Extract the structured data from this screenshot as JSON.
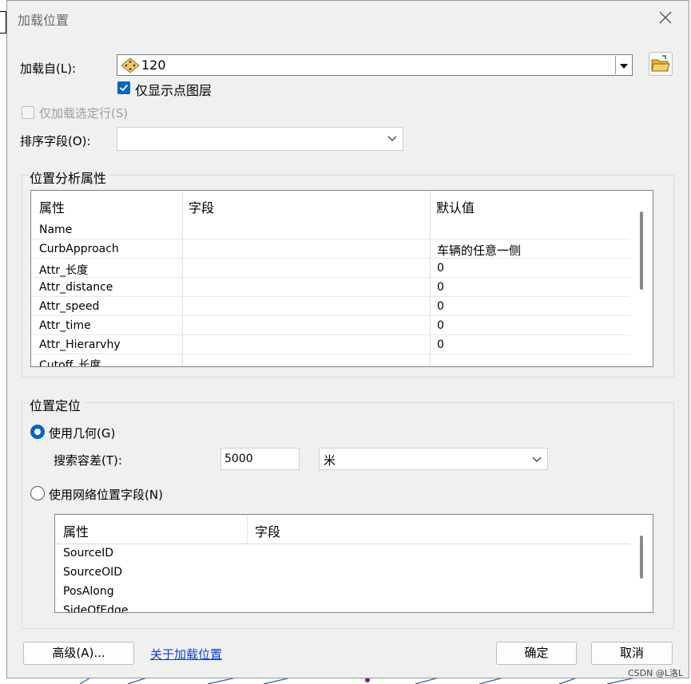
{
  "window": {
    "title": "加载位置",
    "close_icon": "close-icon"
  },
  "load_from": {
    "label": "加载自(L):",
    "value": "120",
    "layer_icon": "point-layer-icon",
    "open_icon": "folder-open-icon"
  },
  "only_point_layers": {
    "label": "仅显示点图层",
    "checked": true
  },
  "only_selected_rows": {
    "label": "仅加载选定行(S)",
    "checked": false,
    "enabled": false
  },
  "sort_field": {
    "label": "排序字段(O):",
    "value": ""
  },
  "analysis_props": {
    "title": "位置分析属性",
    "columns": [
      "属性",
      "字段",
      "默认值"
    ],
    "rows": [
      {
        "prop": "Name",
        "field": "",
        "default": ""
      },
      {
        "prop": "CurbApproach",
        "field": "",
        "default": "车辆的任意一侧"
      },
      {
        "prop": "Attr_长度",
        "field": "",
        "default": "0"
      },
      {
        "prop": "Attr_distance",
        "field": "",
        "default": "0"
      },
      {
        "prop": "Attr_speed",
        "field": "",
        "default": "0"
      },
      {
        "prop": "Attr_time",
        "field": "",
        "default": "0"
      },
      {
        "prop": "Attr_Hierarvhy",
        "field": "",
        "default": "0"
      },
      {
        "prop": "Cutoff_长度",
        "field": "",
        "default": ""
      }
    ]
  },
  "positioning": {
    "title": "位置定位",
    "use_geometry": {
      "label": "使用几何(G)",
      "selected": true
    },
    "tolerance": {
      "label": "搜索容差(T):",
      "value": "5000",
      "unit": "米"
    },
    "use_network_fields": {
      "label": "使用网络位置字段(N)",
      "selected": false
    },
    "columns": [
      "属性",
      "字段"
    ],
    "rows": [
      "SourceID",
      "SourceOID",
      "PosAlong",
      "SideOfEdge"
    ]
  },
  "buttons": {
    "advanced": "高级(A)...",
    "about": "关于加载位置",
    "ok": "确定",
    "cancel": "取消"
  },
  "watermark": "CSDN @L洛L",
  "colors": {
    "accent": "#0067c0",
    "link": "#0b3fd6"
  }
}
